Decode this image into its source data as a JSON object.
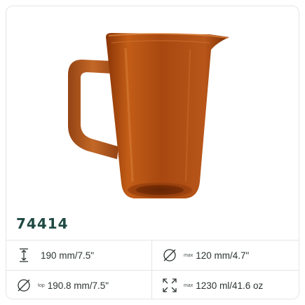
{
  "product": {
    "code": "74414",
    "image_description_icon": "amber-glass-pitcher-image"
  },
  "specs": [
    {
      "icon": "height-icon",
      "prefix": "",
      "value": "190 mm/7.5\""
    },
    {
      "icon": "diameter-icon",
      "prefix": "max",
      "value": "120 mm/4.7\""
    },
    {
      "icon": "diameter-icon",
      "prefix": "top",
      "value": "190.8 mm/7.5\""
    },
    {
      "icon": "expand-arrows-icon",
      "prefix": "max",
      "value": "1230 ml/41.6 oz"
    }
  ],
  "colors": {
    "accent": "#1f4a43",
    "glass_dark": "#7a2d05",
    "glass_mid": "#a5420c",
    "glass_light": "#c8661f",
    "border": "#e3e6e5"
  }
}
